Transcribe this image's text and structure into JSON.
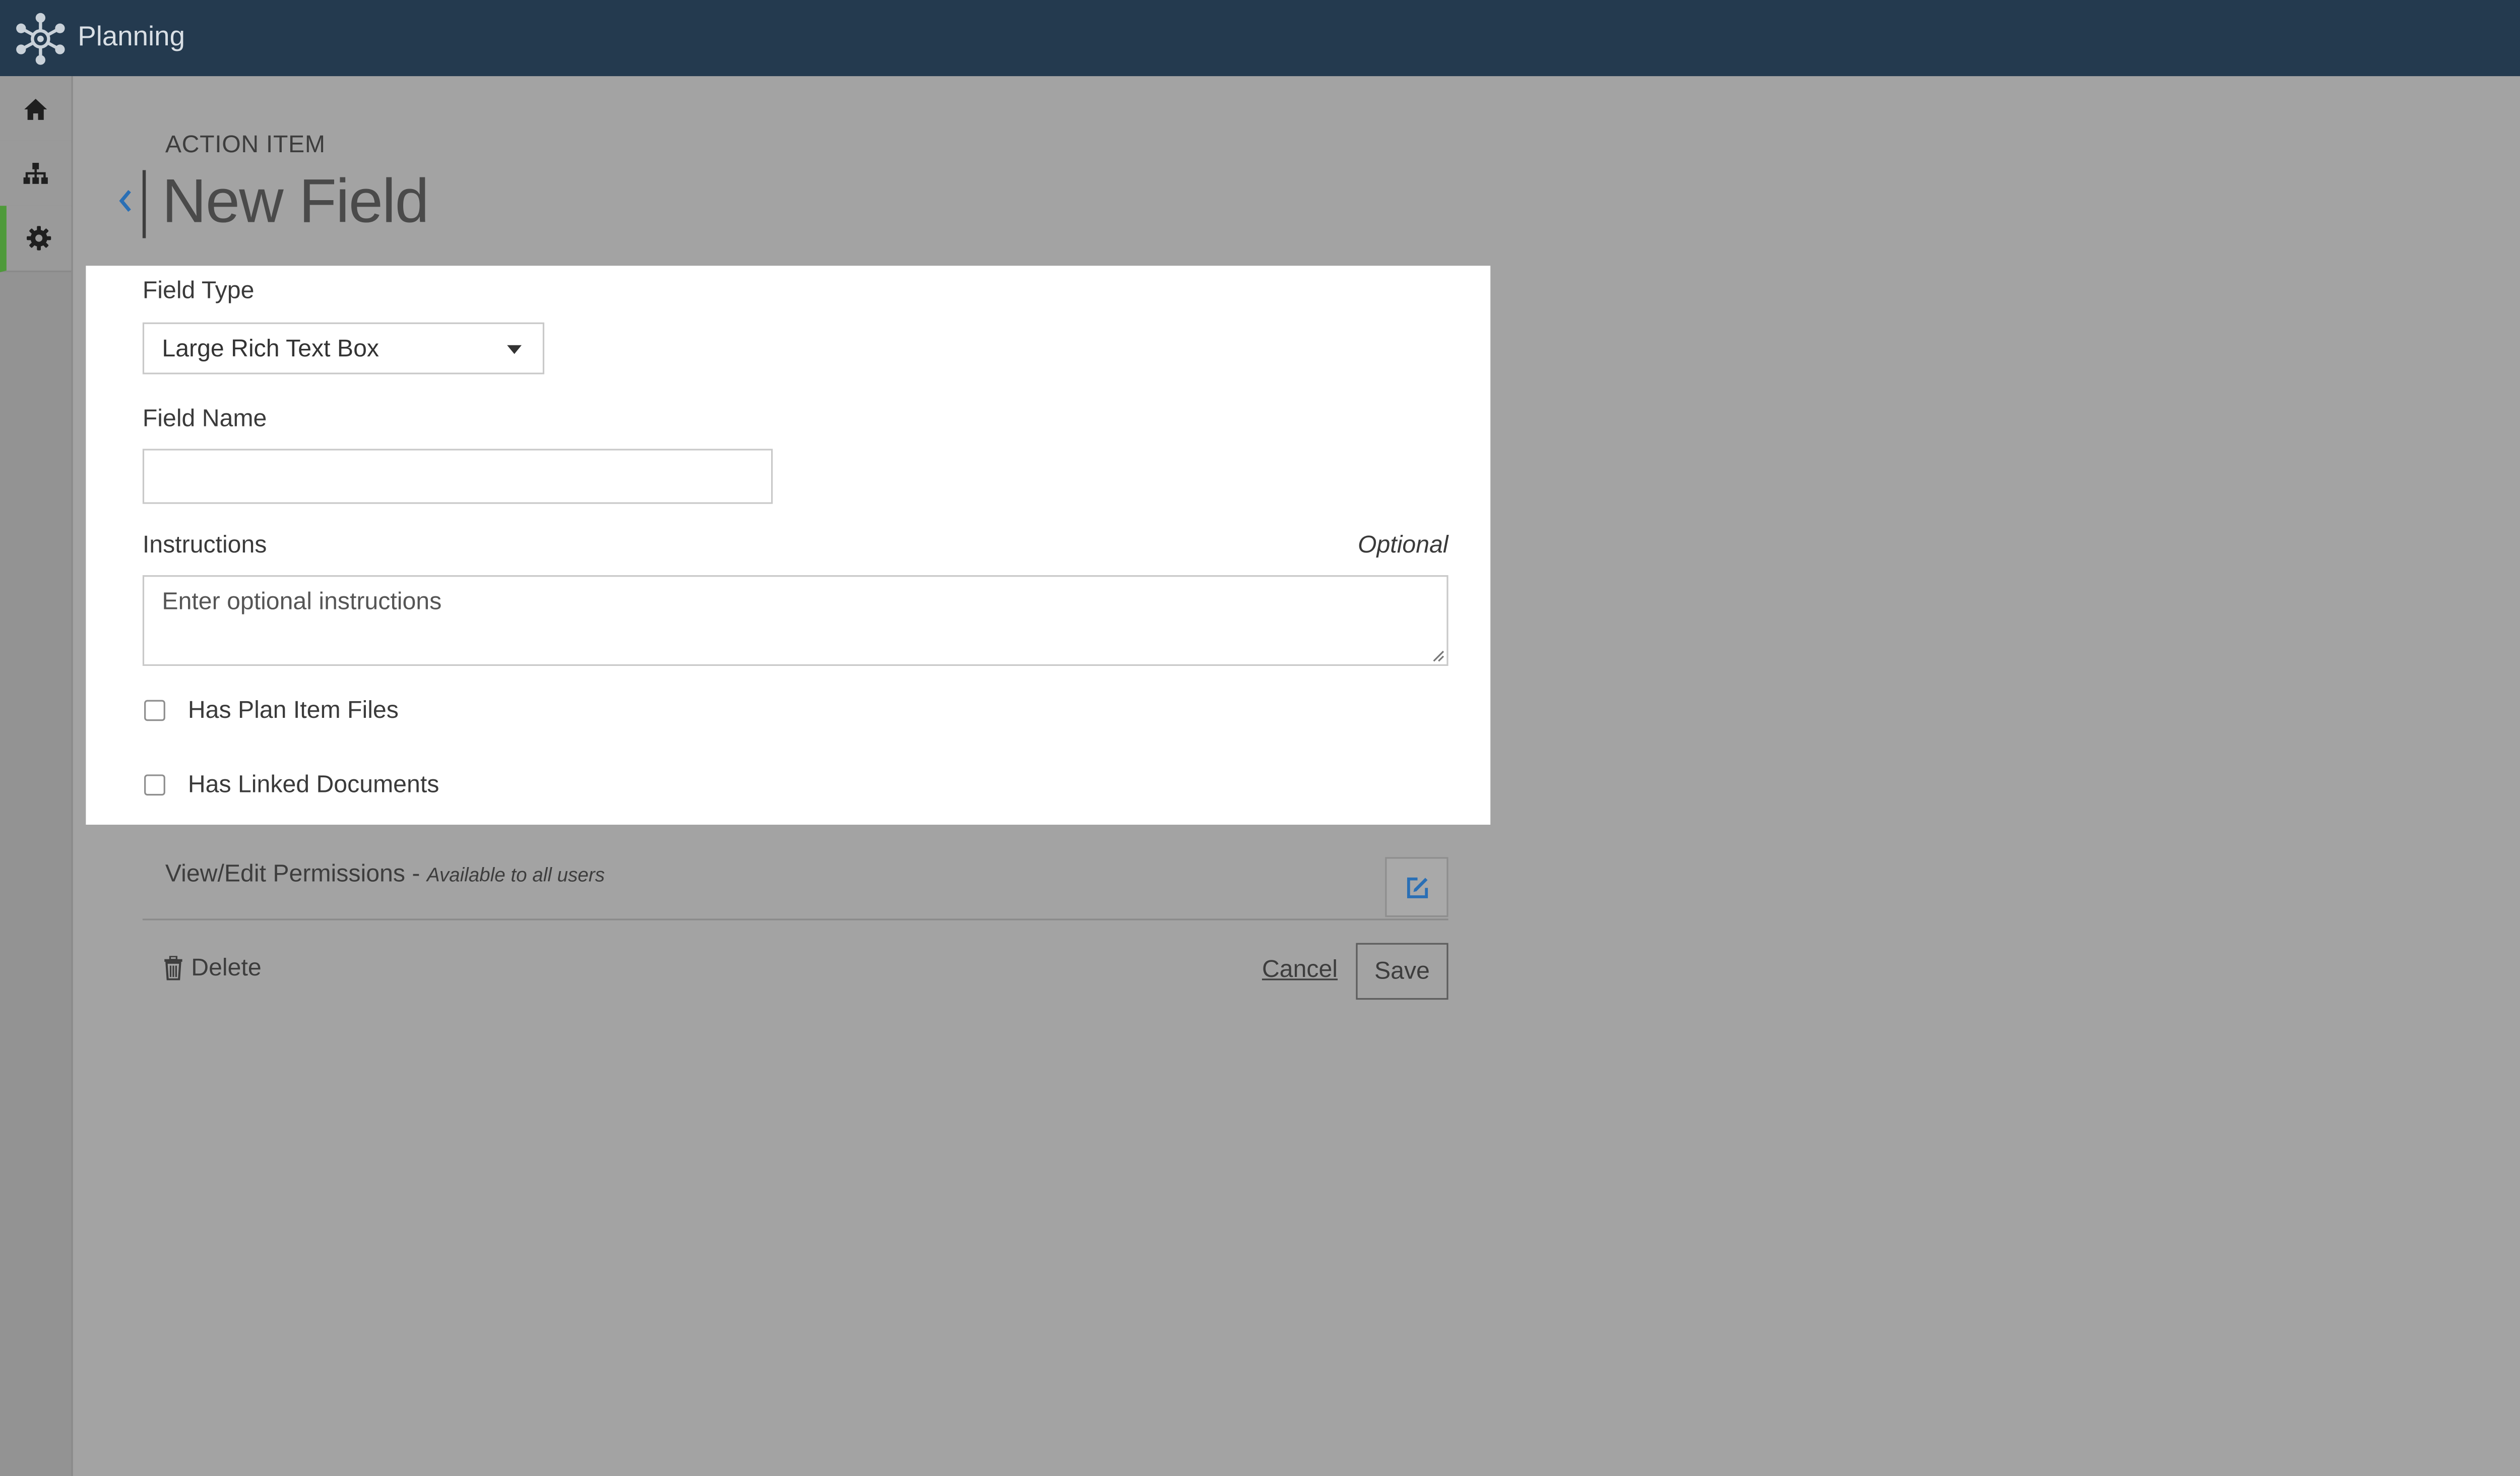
{
  "app": {
    "title": "Planning",
    "logo_icon": "network-hub-icon"
  },
  "colors": {
    "topbar": "#243a4f",
    "overlay_background": "#a3a3a3",
    "active_rail_indicator": "#4e9a3a",
    "link_blue": "#2a6fb5"
  },
  "rail": {
    "items": [
      {
        "name": "home",
        "icon": "home-icon",
        "active": false
      },
      {
        "name": "hierarchy",
        "icon": "sitemap-icon",
        "active": false
      },
      {
        "name": "settings",
        "icon": "gear-icon",
        "active": true
      }
    ]
  },
  "header": {
    "breadcrumb": "ACTION ITEM",
    "title": "New Field",
    "back_icon": "chevron-left-icon"
  },
  "form": {
    "field_type": {
      "label": "Field Type",
      "selected": "Large Rich Text Box"
    },
    "field_name": {
      "label": "Field Name",
      "value": "",
      "placeholder": ""
    },
    "instructions": {
      "label": "Instructions",
      "optional_label": "Optional",
      "value": "",
      "placeholder": "Enter optional instructions"
    },
    "checkboxes": [
      {
        "label": "Has Plan Item Files",
        "checked": false
      },
      {
        "label": "Has Linked Documents",
        "checked": false
      }
    ]
  },
  "permissions": {
    "title": "View/Edit Permissions - ",
    "subtitle": "Available to all users",
    "edit_icon": "edit-square-icon"
  },
  "actions": {
    "delete_label": "Delete",
    "delete_icon": "trash-icon",
    "cancel_label": "Cancel",
    "save_label": "Save"
  }
}
